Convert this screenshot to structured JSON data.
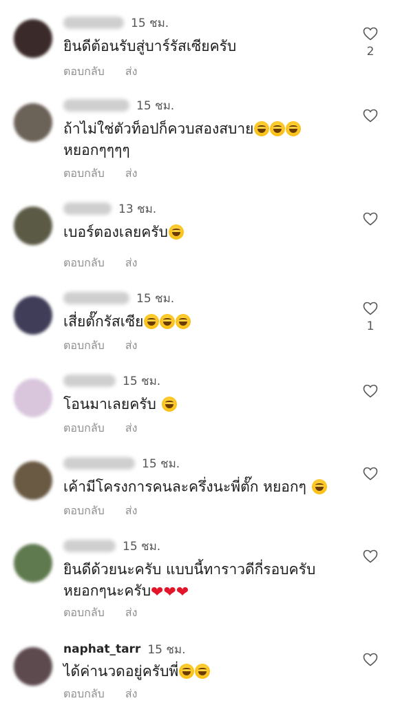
{
  "ui": {
    "reply_label": "ตอบกลับ",
    "send_label": "ส่ง"
  },
  "comments": [
    {
      "username": "",
      "time": "15 ชม.",
      "text": "ยินดีต้อนรับสู่บาร์รัสเซียครับ",
      "emojis": "",
      "line2": "",
      "likes": "2",
      "avatar_color": "#3a2a2a"
    },
    {
      "username": "",
      "time": "15 ชม.",
      "text": "ถ้าไม่ใช่ตัวท็อปก็ควบสองสบาย",
      "emojis": "😄😄😄",
      "line2": "หยอกๆๆๆๆ",
      "likes": "",
      "avatar_color": "#6b6258"
    },
    {
      "username": "",
      "time": "13 ชม.",
      "text": "เบอร์ตองเลยครับ",
      "emojis": "😄",
      "line2": "",
      "likes": "",
      "avatar_color": "#5b5a45"
    },
    {
      "username": "",
      "time": "15 ชม.",
      "text": "เสี่ยตั๊กรัสเซีย",
      "emojis": "😄😄😄",
      "line2": "",
      "likes": "1",
      "avatar_color": "#3f3d58"
    },
    {
      "username": "",
      "time": "15 ชม.",
      "text": "โอนมาเลยครับ ",
      "emojis": "😄",
      "line2": "",
      "likes": "",
      "avatar_color": "#d9c6dd"
    },
    {
      "username": "",
      "time": "15 ชม.",
      "text": "เค้ามีโครงการคนละครึ่งนะพี่ตั๊ก  หยอกๆ ",
      "emojis": "🤣",
      "line2": "",
      "likes": "",
      "avatar_color": "#6a5a44"
    },
    {
      "username": "",
      "time": "15 ชม.",
      "text": "ยินดีด้วยนะครับ แบบนี้ทาราวดีกี่รอบครับ",
      "emojis": "",
      "line2": "หยอกๆนะครับ",
      "line2_hearts": "❤❤❤",
      "likes": "",
      "avatar_color": "#5f7a4f"
    },
    {
      "username": "naphat_tarr",
      "time": "15 ชม.",
      "text": "ได้ค่านวดอยู่ครับพี่",
      "emojis": "🤣🤣",
      "line2": "",
      "likes": "",
      "avatar_color": "#5c4a4e"
    }
  ]
}
